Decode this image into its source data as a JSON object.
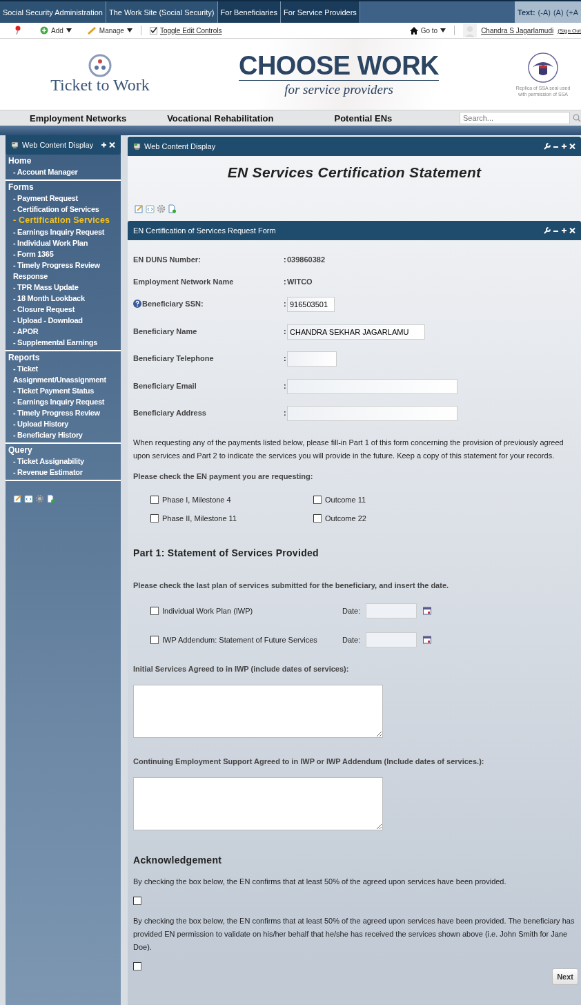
{
  "top_nav": {
    "links": [
      "Social Security Administration",
      "The Work Site (Social Security)",
      "For Beneficiaries",
      "For Service Providers"
    ],
    "text_label": "Text:",
    "text_sizes": [
      "(-A)",
      "(A)",
      "(+A"
    ]
  },
  "toolbar": {
    "add": "Add",
    "manage": "Manage",
    "toggle": {
      "label": "Toggle Edit Controls",
      "checked": true
    },
    "goto": "Go to",
    "user": "Chandra S Jagarlamudi",
    "sign_out": "(Sign Out"
  },
  "banner": {
    "logo_text": "Ticket to Work",
    "title": "CHOOSE WORK",
    "subtitle": "for service providers",
    "seal_caption": "Replica of SSA seal used with permission of SSA"
  },
  "menu": {
    "items": [
      "Employment Networks",
      "Vocational Rehabilitation",
      "Potential ENs"
    ],
    "search": {
      "placeholder": "Search..."
    }
  },
  "sidebar": {
    "portlet_title": "Web Content Display",
    "sections": [
      {
        "title": "Home",
        "items": [
          {
            "label": "- Account Manager",
            "selected": false
          }
        ]
      },
      {
        "title": "Forms",
        "items": [
          {
            "label": "- Payment Request",
            "selected": false
          },
          {
            "label": "- Certification of Services",
            "selected": false
          },
          {
            "label": "- Certification Services",
            "selected": true
          },
          {
            "label": "- Earnings Inquiry Request",
            "selected": false
          },
          {
            "label": "- Individual Work Plan",
            "selected": false
          },
          {
            "label": "- Form 1365",
            "selected": false
          },
          {
            "label": "- Timely Progress Review Response",
            "selected": false
          },
          {
            "label": "- TPR Mass Update",
            "selected": false
          },
          {
            "label": "- 18 Month Lookback",
            "selected": false
          },
          {
            "label": "- Closure Request",
            "selected": false
          },
          {
            "label": "- Upload - Download",
            "selected": false
          },
          {
            "label": "- APOR",
            "selected": false
          },
          {
            "label": "- Supplemental Earnings",
            "selected": false
          }
        ]
      },
      {
        "title": "Reports",
        "items": [
          {
            "label": "- Ticket Assignment/Unassignment",
            "selected": false
          },
          {
            "label": "- Ticket Payment Status",
            "selected": false
          },
          {
            "label": "- Earnings Inquiry Request",
            "selected": false
          },
          {
            "label": "- Timely Progress Review",
            "selected": false
          },
          {
            "label": "- Upload History",
            "selected": false
          },
          {
            "label": "- Beneficiary History",
            "selected": false
          }
        ]
      },
      {
        "title": "Query",
        "items": [
          {
            "label": "- Ticket Assignability",
            "selected": false
          },
          {
            "label": "- Revenue Estimator",
            "selected": false
          }
        ]
      }
    ]
  },
  "content": {
    "portlet_title": "Web Content Display",
    "heading": "EN Services Certification Statement",
    "form_title": "EN Certification of Services Request Form",
    "fields": [
      {
        "label": "EN DUNS Number:",
        "kind": "static",
        "colon": ":",
        "value": "039860382",
        "help": false
      },
      {
        "label": "Employment Network Name",
        "kind": "static",
        "colon": ":",
        "value": "WITCO",
        "help": false
      },
      {
        "label": "Beneficiary SSN:",
        "kind": "input",
        "colon": ":",
        "value": "916503501",
        "help": true
      },
      {
        "label": "Beneficiary Name",
        "kind": "input",
        "colon": ":",
        "value": "CHANDRA SEKHAR JAGARLAMU",
        "help": false
      },
      {
        "label": "Beneficiary Telephone",
        "kind": "input",
        "colon": ":",
        "help": false
      },
      {
        "label": "Beneficiary Email",
        "kind": "input",
        "colon": ":",
        "help": false
      },
      {
        "label": "Beneficiary Address",
        "kind": "input",
        "colon": ":",
        "help": false
      }
    ],
    "intro": "When requesting any of the payments listed below, please fill-in Part 1 of this form concerning the provision of previously agreed upon services and Part 2 to indicate the services you will provide in the future. Keep a copy of this statement for your records.",
    "payment_prompt": "Please check the EN payment you are requesting:",
    "payment_options": [
      {
        "label": "Phase I, Milestone 4",
        "checked": false
      },
      {
        "label": "Outcome 11",
        "checked": false
      },
      {
        "label": "Phase II, Milestone 11",
        "checked": false
      },
      {
        "label": "Outcome 22",
        "checked": false
      }
    ],
    "part1_heading": "Part 1: Statement of Services Provided",
    "plan_prompt": "Please check the last plan of services submitted for the beneficiary, and insert the date.",
    "plans": [
      {
        "label": "Individual Work Plan (IWP)",
        "checked": false,
        "date_label": "Date:"
      },
      {
        "label": "IWP Addendum: Statement of Future Services",
        "checked": false,
        "date_label": "Date:"
      }
    ],
    "text_areas": [
      {
        "label": "Initial Services Agreed to in IWP (include dates of services):"
      },
      {
        "label": "Continuing Employment Support Agreed to in IWP or IWP Addendum (Include dates of services.):"
      }
    ],
    "ack_heading": "Acknowledgement",
    "acknowledgements": [
      {
        "text": "By checking the box below, the EN confirms that at least 50% of the agreed upon services have been provided.",
        "checked": false
      },
      {
        "text": "By checking the box below, the EN confirms that at least 50% of the agreed upon services have been provided. The beneficiary has provided EN permission to validate on his/her behalf that he/she has received the services shown above (i.e. John Smith for Jane Doe).",
        "checked": false
      }
    ],
    "next_button": "Next"
  }
}
